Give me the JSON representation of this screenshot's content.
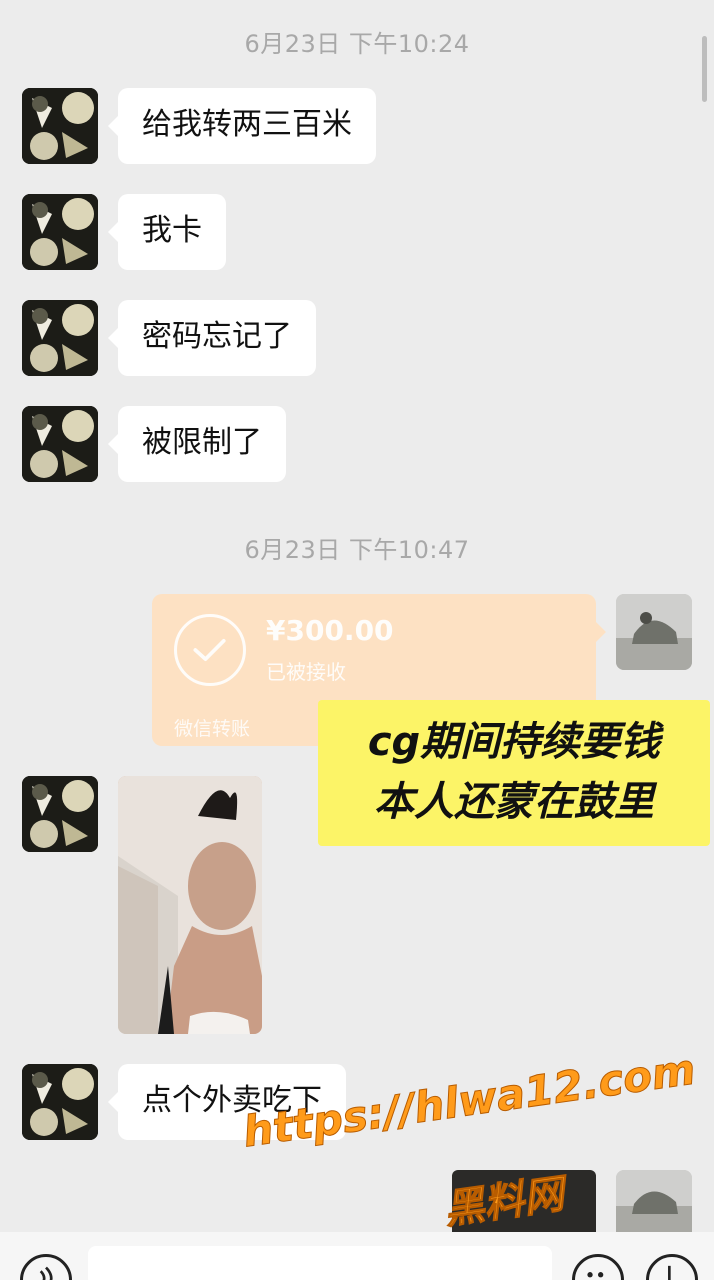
{
  "timestamps": [
    "6月23日 下午10:24",
    "6月23日 下午10:47"
  ],
  "messages": {
    "m1": "给我转两三百米",
    "m2": "我卡",
    "m3": "密码忘记了",
    "m4": "被限制了",
    "m5": "点个外卖吃下"
  },
  "transfer": {
    "amount": "¥300.00",
    "status": "已被接收",
    "label": "微信转账"
  },
  "caption": {
    "line1": "cg期间持续要钱",
    "line2": "本人还蒙在鼓里"
  },
  "watermark": {
    "url": "https://hlwa12.com",
    "name": "黑料网"
  },
  "icons": {
    "voice": "voice-icon",
    "emoji": "emoji-icon",
    "plus": "plus-icon",
    "check": "check-icon"
  },
  "colors": {
    "background": "#ececec",
    "transfer": "#fde1c3",
    "caption": "#fcf467",
    "watermark": "#ff9b1a"
  }
}
